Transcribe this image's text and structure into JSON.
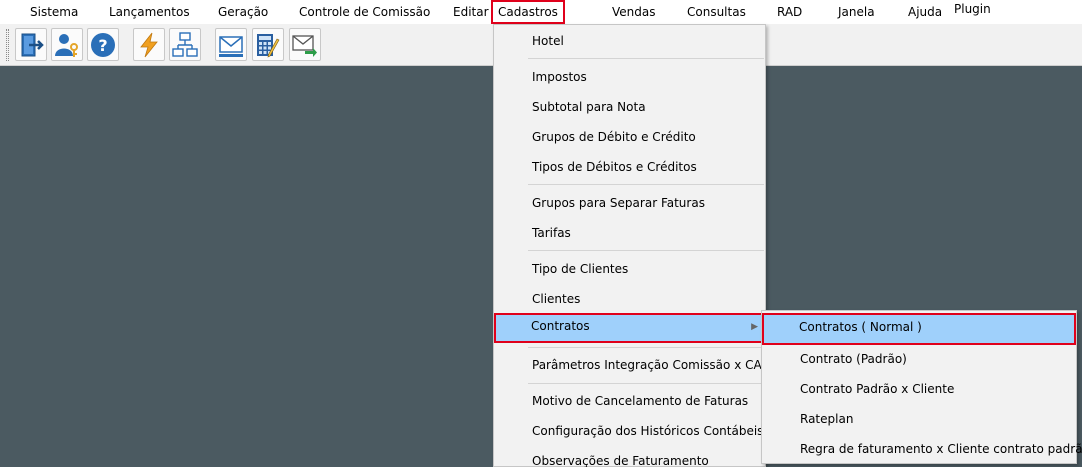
{
  "menubar": {
    "items": [
      "Sistema",
      "Lançamentos",
      "Geração",
      "Controle de Comissão",
      "Editar",
      "Cadastros",
      "Vendas",
      "Consultas",
      "RAD",
      "Janela",
      "Ajuda",
      "Plugin"
    ]
  },
  "toolbar": {
    "buttons": [
      {
        "icon": "exit-door-icon"
      },
      {
        "icon": "user-key-icon"
      },
      {
        "icon": "help-icon"
      },
      {
        "icon": "lightning-icon"
      },
      {
        "icon": "network-diagram-icon"
      },
      {
        "icon": "envelope-icon"
      },
      {
        "icon": "calculator-pen-icon"
      },
      {
        "icon": "envelope-send-icon"
      }
    ]
  },
  "cadastros_menu": {
    "items": [
      "Hotel",
      "Impostos",
      "Subtotal para Nota",
      "Grupos de Débito e Crédito",
      "Tipos de Débitos e Créditos",
      "Grupos para Separar Faturas",
      "Tarifas",
      "Tipo de Clientes",
      "Clientes",
      "Contratos",
      "Parâmetros Integração Comissão x CAP",
      "Motivo de Cancelamento de Faturas",
      "Configuração dos Históricos Contábeis",
      "Observações de Faturamento"
    ],
    "submenu_arrow": "▶"
  },
  "contratos_submenu": {
    "items": [
      "Contratos ( Normal )",
      "Contrato (Padrão)",
      "Contrato Padrão x Cliente",
      "Rateplan",
      "Regra de faturamento x Cliente contrato padrão"
    ]
  },
  "colors": {
    "workspace": "#4b5a61",
    "highlight": "#9fd0fb",
    "annotation_border": "#e0001b"
  }
}
